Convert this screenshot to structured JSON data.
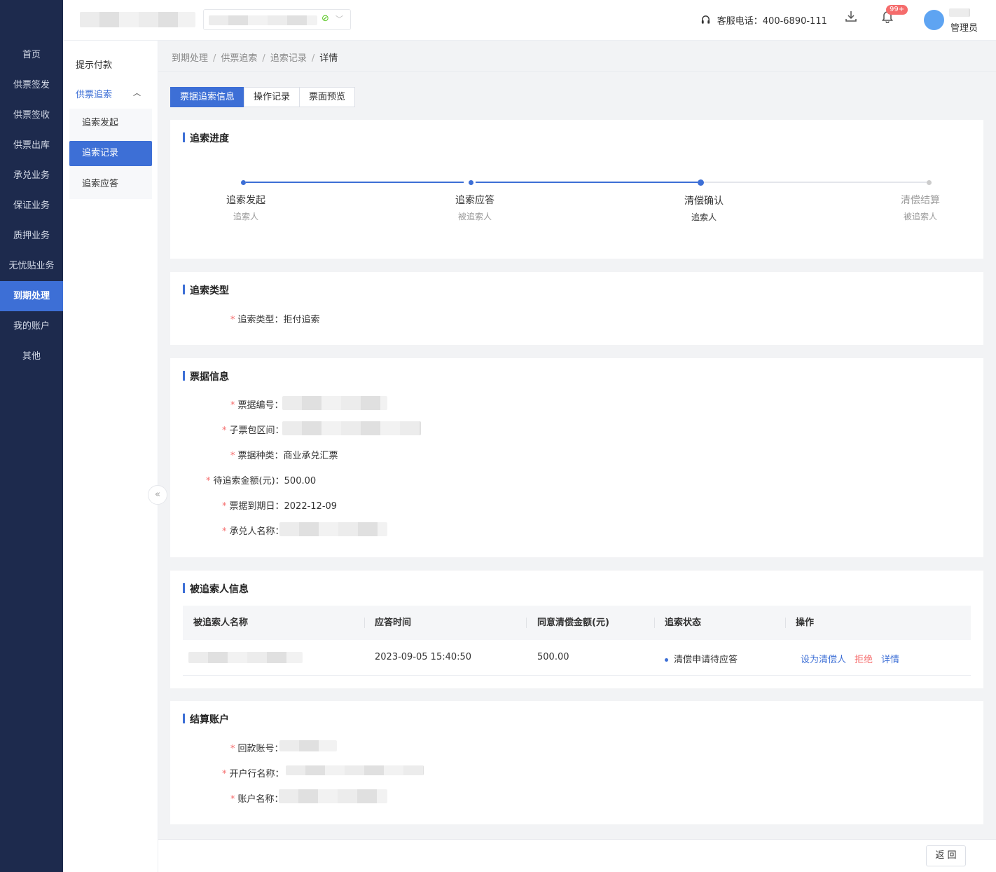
{
  "sidebar": {
    "items": [
      {
        "label": "首页"
      },
      {
        "label": "供票签发"
      },
      {
        "label": "供票签收"
      },
      {
        "label": "供票出库"
      },
      {
        "label": "承兑业务"
      },
      {
        "label": "保证业务"
      },
      {
        "label": "质押业务"
      },
      {
        "label": "无忧贴业务"
      },
      {
        "label": "到期处理"
      },
      {
        "label": "我的账户"
      },
      {
        "label": "其他"
      }
    ],
    "active": "到期处理"
  },
  "header": {
    "hotline_label": "客服电话：400-6890-111",
    "notification_badge": "99+",
    "user_role": "管理员",
    "icons": {
      "hotline": "headset-icon",
      "download": "download-icon",
      "notification": "bell-icon",
      "company_status": "check-circle-icon",
      "company_select": "chevron-down-icon"
    }
  },
  "subnav": {
    "top_item": "提示付款",
    "group_label": "供票追索",
    "group_icon": "chevron-up-icon",
    "items": [
      {
        "label": "追索发起"
      },
      {
        "label": "追索记录"
      },
      {
        "label": "追索应答"
      }
    ],
    "active": "追索记录",
    "collapse_icon": "double-chevron-left-icon"
  },
  "breadcrumb": {
    "items": [
      "到期处理",
      "供票追索",
      "追索记录"
    ],
    "current": "详情",
    "separator": "/"
  },
  "tabs": [
    {
      "label": "票据追索信息",
      "active": true
    },
    {
      "label": "操作记录",
      "active": false
    },
    {
      "label": "票面预览",
      "active": false
    }
  ],
  "progress": {
    "title": "追索进度",
    "steps": [
      {
        "title": "追索发起",
        "sub": "追索人",
        "status": "done"
      },
      {
        "title": "追索应答",
        "sub": "被追索人",
        "status": "done"
      },
      {
        "title": "清偿确认",
        "sub": "追索人",
        "status": "current"
      },
      {
        "title": "清偿结算",
        "sub": "被追索人",
        "status": "pending"
      }
    ]
  },
  "recourse_type": {
    "title": "追索类型",
    "label": "追索类型：",
    "value": "拒付追索"
  },
  "bill_info": {
    "title": "票据信息",
    "fields": [
      {
        "label": "票据编号：",
        "value": ""
      },
      {
        "label": "子票包区间：",
        "value": ""
      },
      {
        "label": "票据种类：",
        "value": "商业承兑汇票"
      },
      {
        "label": "待追索金额(元)：",
        "value": "500.00"
      },
      {
        "label": "票据到期日：",
        "value": "2022-12-09"
      },
      {
        "label": "承兑人名称：",
        "value": ""
      }
    ]
  },
  "respondent": {
    "title": "被追索人信息",
    "columns": [
      "被追索人名称",
      "应答时间",
      "同意清偿金额(元)",
      "追索状态",
      "操作"
    ],
    "rows": [
      {
        "name": "",
        "time": "2023-09-05 15:40:50",
        "amount": "500.00",
        "status": "清偿申请待应答",
        "actions": {
          "set_payer": "设为清偿人",
          "reject": "拒绝",
          "detail": "详情"
        }
      }
    ]
  },
  "settlement": {
    "title": "结算账户",
    "fields": [
      {
        "label": "回款账号：",
        "value": ""
      },
      {
        "label": "开户行名称：",
        "value": ""
      },
      {
        "label": "账户名称：",
        "value": ""
      }
    ]
  },
  "footer": {
    "back_label": "返 回"
  },
  "colors": {
    "sidebar_bg": "#1d2a4d",
    "primary": "#3d6fd6",
    "danger": "#f56c6c",
    "success": "#52c41a"
  }
}
